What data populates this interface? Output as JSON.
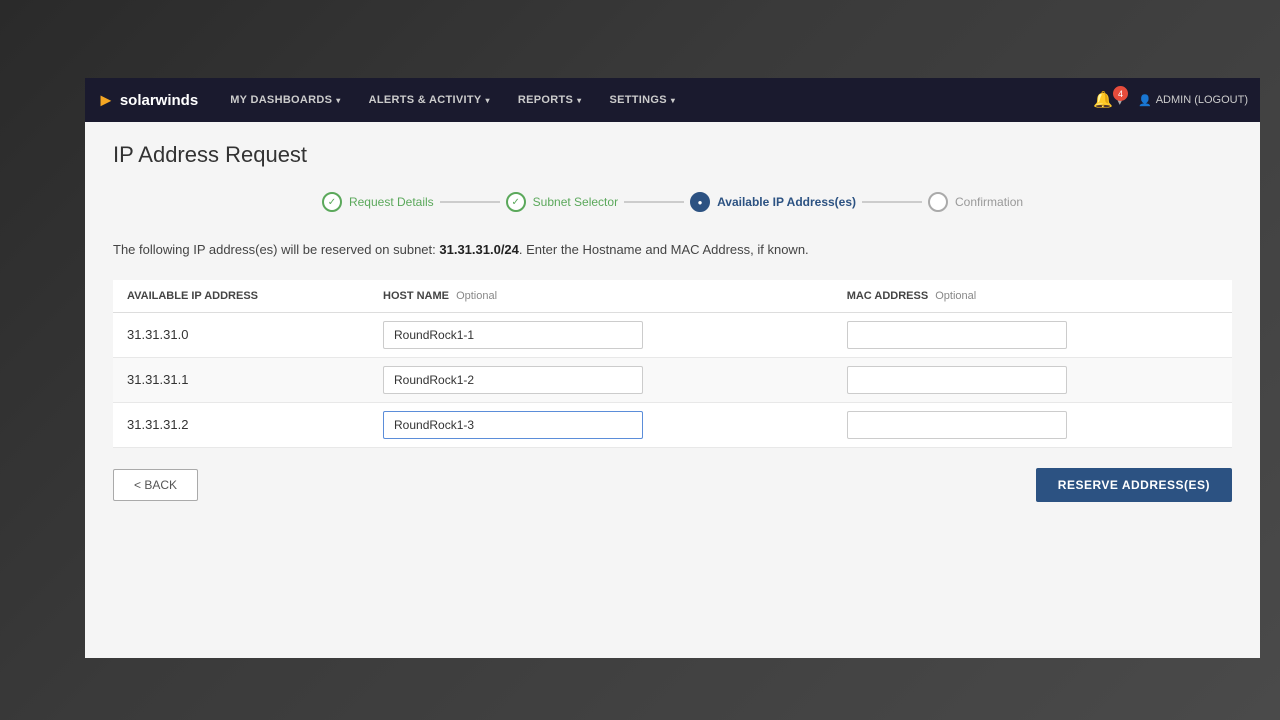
{
  "brand": {
    "name": "solarwinds",
    "icon": "▶"
  },
  "navbar": {
    "items": [
      {
        "label": "MY DASHBOARDS",
        "has_arrow": true
      },
      {
        "label": "ALERTS & ACTIVITY",
        "has_arrow": true
      },
      {
        "label": "REPORTS",
        "has_arrow": true
      },
      {
        "label": "SETTINGS",
        "has_arrow": true
      }
    ],
    "notification_count": "4",
    "admin_label": "ADMIN (LOGOUT)"
  },
  "page": {
    "title": "IP Address Request"
  },
  "wizard": {
    "steps": [
      {
        "label": "Request Details",
        "state": "completed"
      },
      {
        "label": "Subnet Selector",
        "state": "completed"
      },
      {
        "label": "Available IP Address(es)",
        "state": "active"
      },
      {
        "label": "Confirmation",
        "state": "inactive"
      }
    ],
    "connector_count": 3
  },
  "description": {
    "prefix": "The following IP address(es) will be reserved on subnet: ",
    "subnet": "31.31.31.0/24",
    "suffix": ". Enter the Hostname and MAC Address, if known."
  },
  "table": {
    "columns": [
      {
        "label": "AVAILABLE IP ADDRESS",
        "optional": false
      },
      {
        "label": "HOST NAME",
        "optional": true,
        "optional_text": "Optional"
      },
      {
        "label": "MAC ADDRESS",
        "optional": true,
        "optional_text": "Optional"
      }
    ],
    "rows": [
      {
        "ip": "31.31.31.0",
        "hostname": "RoundRock1-1",
        "mac": ""
      },
      {
        "ip": "31.31.31.1",
        "hostname": "RoundRock1-2",
        "mac": ""
      },
      {
        "ip": "31.31.31.2",
        "hostname": "RoundRock1-3",
        "mac": "",
        "active": true
      }
    ]
  },
  "buttons": {
    "back_label": "< BACK",
    "reserve_label": "RESERVE ADDRESS(ES)"
  }
}
